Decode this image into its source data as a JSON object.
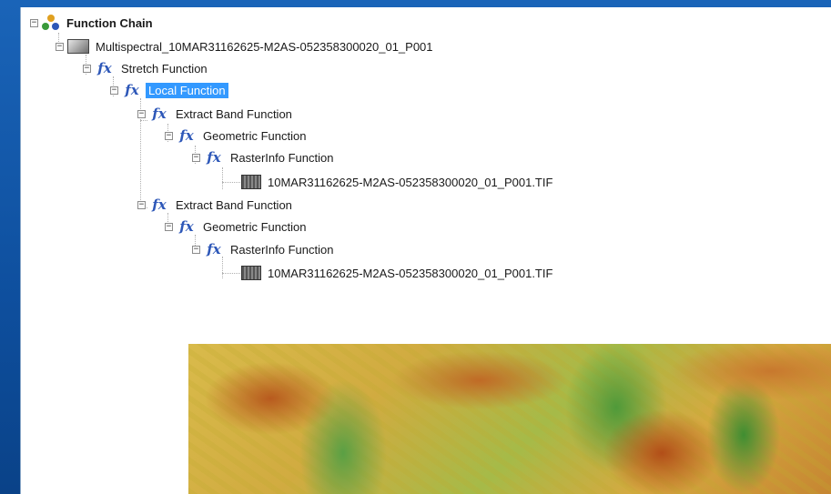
{
  "tree": {
    "root": {
      "label": "Function Chain",
      "icon": "function-chain-icon"
    },
    "items": [
      {
        "label": "Multispectral_10MAR31162625-M2AS-052358300020_01_P001",
        "icon": "multispectral-layer-icon"
      },
      {
        "label": "Stretch Function",
        "icon": "fx-icon"
      },
      {
        "label": "Local Function",
        "icon": "fx-icon",
        "selected": true
      },
      {
        "label": "Extract Band Function",
        "icon": "fx-icon"
      },
      {
        "label": "Geometric Function",
        "icon": "fx-icon"
      },
      {
        "label": "RasterInfo Function",
        "icon": "fx-icon"
      },
      {
        "label": "10MAR31162625-M2AS-052358300020_01_P001.TIF",
        "icon": "raster-file-icon"
      },
      {
        "label": "Extract Band Function",
        "icon": "fx-icon"
      },
      {
        "label": "Geometric Function",
        "icon": "fx-icon"
      },
      {
        "label": "RasterInfo Function",
        "icon": "fx-icon"
      },
      {
        "label": "10MAR31162625-M2AS-052358300020_01_P001.TIF",
        "icon": "raster-file-icon"
      }
    ],
    "collapse_glyph": "−",
    "fx_glyph": "fx"
  },
  "colors": {
    "background_blue": "#0e4f9e",
    "selection": "#3399ff",
    "fx_blue": "#2d57b8"
  }
}
